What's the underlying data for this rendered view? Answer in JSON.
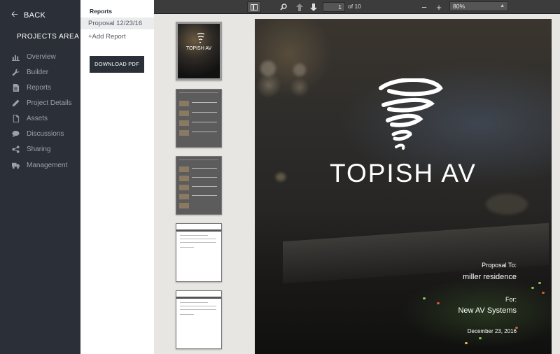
{
  "nav": {
    "back_label": "BACK",
    "area_title": "PROJECTS AREA",
    "items": [
      {
        "label": "Overview",
        "icon": "chart-icon"
      },
      {
        "label": "Builder",
        "icon": "wrench-icon"
      },
      {
        "label": "Reports",
        "icon": "document-icon"
      },
      {
        "label": "Project Details",
        "icon": "pencil-icon"
      },
      {
        "label": "Assets",
        "icon": "file-icon"
      },
      {
        "label": "Discussions",
        "icon": "chat-icon"
      },
      {
        "label": "Sharing",
        "icon": "share-icon"
      },
      {
        "label": "Management",
        "icon": "truck-icon"
      }
    ]
  },
  "reports": {
    "title": "Reports",
    "items": [
      {
        "label": "Proposal 12/23/16",
        "selected": true
      }
    ],
    "add_label": "+Add Report",
    "download_label": "DOWNLOAD PDF"
  },
  "viewer": {
    "page_current": "1",
    "page_of": "of 10",
    "zoom": "80%",
    "thumbnail_logo": "TOPISH AV"
  },
  "document": {
    "brand": "TOPISH AV",
    "proposal_to_label": "Proposal To:",
    "client": "miller residence",
    "for_label": "For:",
    "company": "New AV Systems",
    "date": "December 23, 2016"
  },
  "colors": {
    "sidebar_bg": "#2b3038",
    "viewer_bg": "#e7e6e2",
    "toolbar_bg": "#3c3c3c"
  }
}
